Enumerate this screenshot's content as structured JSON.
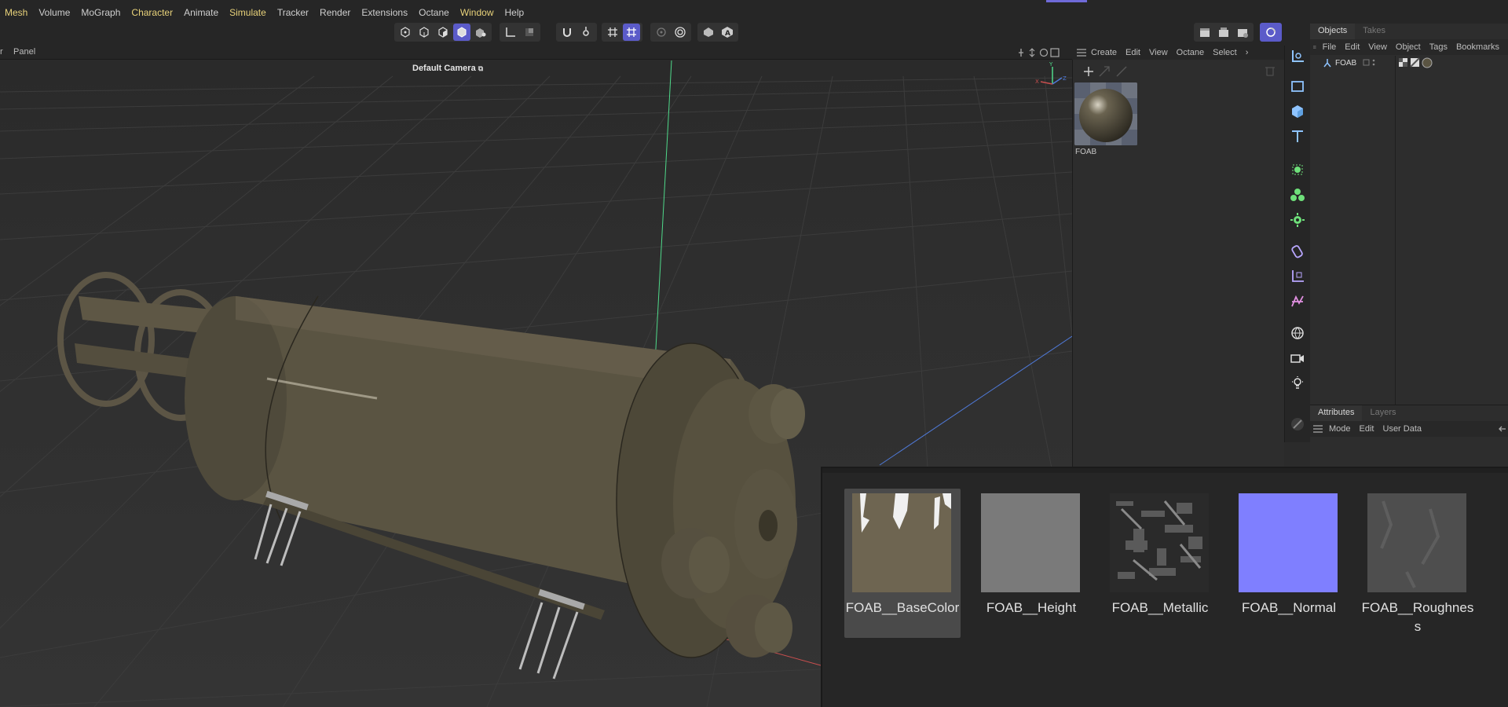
{
  "menubar": {
    "items": [
      "Mesh",
      "Volume",
      "MoGraph",
      "Character",
      "Animate",
      "Simulate",
      "Tracker",
      "Render",
      "Extensions",
      "Octane",
      "Window",
      "Help"
    ]
  },
  "viewport": {
    "menu": [
      "r",
      "Panel"
    ],
    "camera_label": "Default Camera"
  },
  "material_manager": {
    "menu": [
      "Create",
      "Edit",
      "View",
      "Octane",
      "Select",
      "›"
    ],
    "material_name": "FOAB"
  },
  "objects_panel": {
    "tabs": [
      "Objects",
      "Takes"
    ],
    "menu": [
      "File",
      "Edit",
      "View",
      "Object",
      "Tags",
      "Bookmarks"
    ],
    "object_name": "FOAB"
  },
  "attributes_panel": {
    "tabs": [
      "Attributes",
      "Layers"
    ],
    "menu": [
      "Mode",
      "Edit",
      "User Data"
    ]
  },
  "texture_browser": {
    "textures": [
      {
        "label": "FOAB__BaseColor",
        "kind": "basecolor",
        "color": "#6e6551"
      },
      {
        "label": "FOAB__Height",
        "kind": "height",
        "color": "#7a7a7a"
      },
      {
        "label": "FOAB__Metallic",
        "kind": "metallic",
        "color": "#2a2a2a"
      },
      {
        "label": "FOAB__Normal",
        "kind": "normal",
        "color": "#7f7fff"
      },
      {
        "label": "FOAB__Roughness",
        "kind": "roughness",
        "color": "#4e4e4e"
      }
    ]
  },
  "colors": {
    "accent": "#5b5bc9",
    "menu_highlight": "#e8d27a",
    "background": "#2b2b2b"
  }
}
